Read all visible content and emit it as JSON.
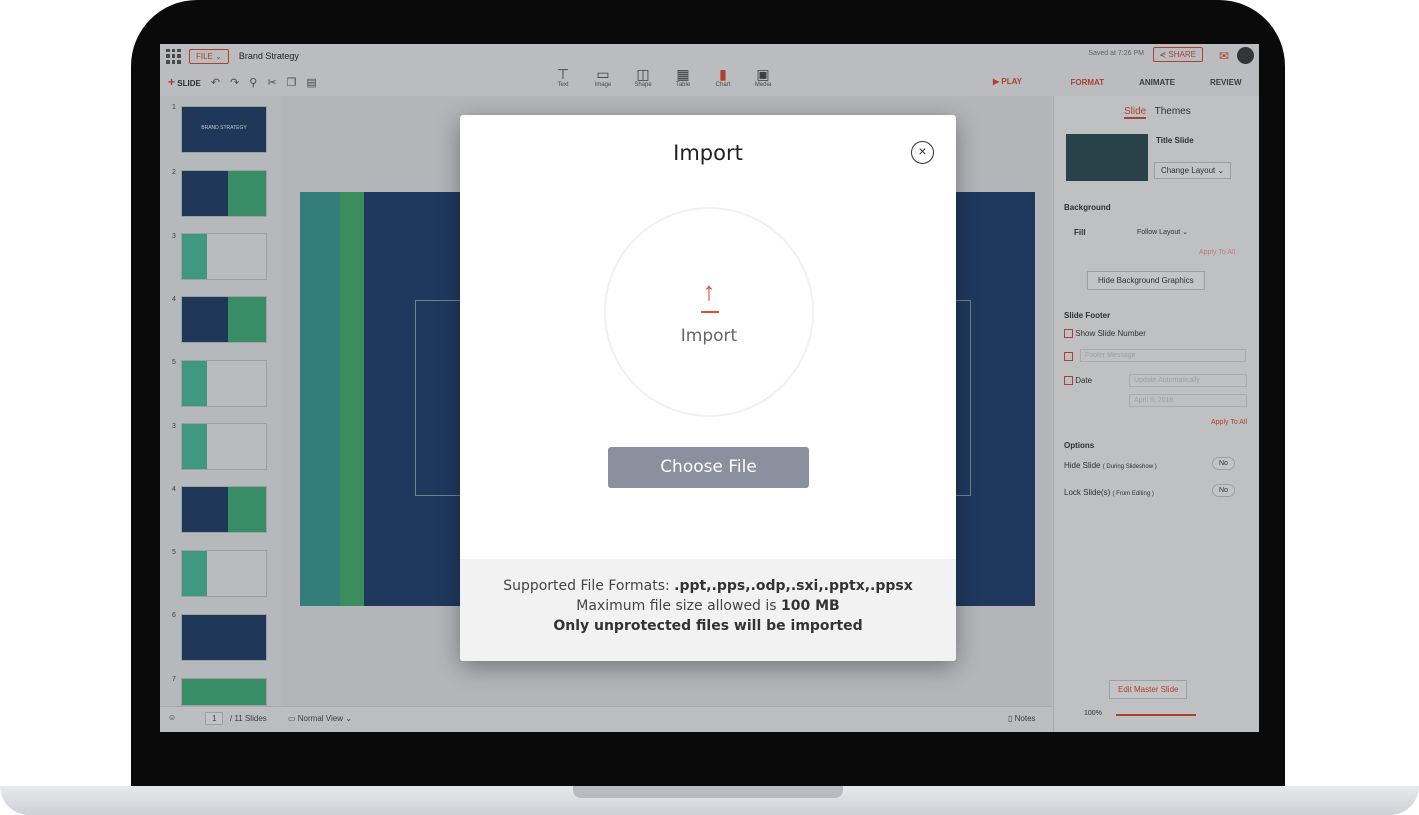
{
  "app": {
    "file_menu": "FILE ⌄",
    "doc_title": "Brand Strategy",
    "saved_status": "Saved at 7:26 PM",
    "share_label": "SHARE",
    "slide_label": "SLIDE",
    "play_label": "PLAY",
    "inserts": [
      {
        "label": "Text",
        "icon": "text-box-icon"
      },
      {
        "label": "Image",
        "icon": "image-icon"
      },
      {
        "label": "Shape",
        "icon": "shape-icon"
      },
      {
        "label": "Table",
        "icon": "table-icon"
      },
      {
        "label": "Chart",
        "icon": "chart-icon"
      },
      {
        "label": "Media",
        "icon": "media-icon"
      }
    ],
    "right_tabs": [
      "FORMAT",
      "ANIMATE",
      "REVIEW"
    ],
    "accent": "#e04b2d"
  },
  "thumbnails": {
    "numbers": [
      "1",
      "2",
      "3",
      "4",
      "5",
      "3",
      "4",
      "5",
      "6",
      "7"
    ],
    "first_title": "BRAND STRATEGY"
  },
  "right_panel": {
    "tabs": [
      "Slide",
      "Themes"
    ],
    "layout_name": "Title Slide",
    "change_layout": "Change Layout ⌄",
    "background": "Background",
    "fill": "Fill",
    "follow_layout": "Follow Layout ⌄",
    "apply_to_all_1": "Apply To All",
    "hide_bg": "Hide Background Graphics",
    "slide_footer": "Slide Footer",
    "show_slide_number": "Show Slide Number",
    "footer_message": "Footer Message",
    "date": "Date",
    "update_auto": "Update Automatically",
    "date_value": "April 6, 2018",
    "apply_to_all_2": "Apply To All",
    "options": "Options",
    "hide_slide": "Hide Slide",
    "hide_slide_note": "( During Slideshow )",
    "lock_slide": "Lock Slide(s)",
    "lock_slide_note": "( From Editing )",
    "no": "No",
    "edit_master": "Edit Master Slide",
    "zoom": "100%"
  },
  "bottom": {
    "page": "1",
    "slides": "/ 11 Slides",
    "view": "Normal View ⌄",
    "notes": "Notes"
  },
  "modal": {
    "title": "Import",
    "circle_label": "Import",
    "choose_file": "Choose File",
    "formats_prefix": "Supported File Formats: ",
    "formats": ".ppt,.pps,.odp,.sxi,.pptx,.ppsx",
    "max_prefix": "Maximum file size allowed is ",
    "max_size": "100 MB",
    "protected_note": "Only unprotected files will be imported"
  }
}
